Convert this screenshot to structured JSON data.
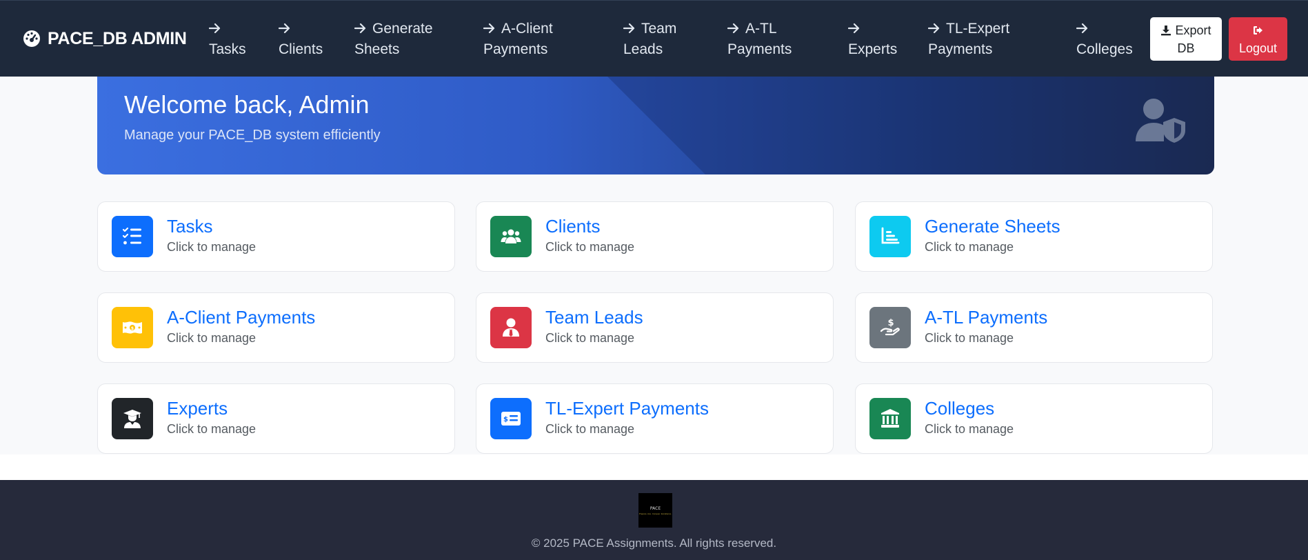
{
  "navbar": {
    "brand": "PACE_DB ADMIN",
    "links": [
      {
        "line1": "Tasks",
        "line2": ""
      },
      {
        "line1": "Clients",
        "line2": ""
      },
      {
        "line1": "Generate",
        "line2": "Sheets"
      },
      {
        "line1": "A-Client",
        "line2": "Payments"
      },
      {
        "line1": "Team",
        "line2": "Leads"
      },
      {
        "line1": "A-TL",
        "line2": "Payments"
      },
      {
        "line1": "Experts",
        "line2": ""
      },
      {
        "line1": "TL-Expert",
        "line2": "Payments"
      },
      {
        "line1": "Colleges",
        "line2": ""
      }
    ],
    "export_line1": "Export",
    "export_line2": "DB",
    "logout_label": "Logout"
  },
  "hero": {
    "title": "Welcome back, Admin",
    "subtitle": "Manage your PACE_DB system efficiently"
  },
  "cards": [
    {
      "title": "Tasks",
      "subtitle": "Click to manage",
      "color": "#0d6efd",
      "icon": "tasks-icon"
    },
    {
      "title": "Clients",
      "subtitle": "Click to manage",
      "color": "#198754",
      "icon": "users-icon"
    },
    {
      "title": "Generate Sheets",
      "subtitle": "Click to manage",
      "color": "#0dcaf0",
      "icon": "chart-icon"
    },
    {
      "title": "A-Client Payments",
      "subtitle": "Click to manage",
      "color": "#ffc107",
      "icon": "money-icon"
    },
    {
      "title": "Team Leads",
      "subtitle": "Click to manage",
      "color": "#dc3545",
      "icon": "user-tie-icon"
    },
    {
      "title": "A-TL Payments",
      "subtitle": "Click to manage",
      "color": "#6c757d",
      "icon": "hand-dollar-icon"
    },
    {
      "title": "Experts",
      "subtitle": "Click to manage",
      "color": "#212529",
      "icon": "graduate-icon"
    },
    {
      "title": "TL-Expert Payments",
      "subtitle": "Click to manage",
      "color": "#0d6efd",
      "icon": "money-check-icon"
    },
    {
      "title": "Colleges",
      "subtitle": "Click to manage",
      "color": "#198754",
      "icon": "university-icon"
    }
  ],
  "footer": {
    "logo_text": "PACE",
    "logo_tagline": "Prepare. Ace. Conquer. Excellence.",
    "copyright": "© 2025 PACE Assignments. All rights reserved."
  }
}
